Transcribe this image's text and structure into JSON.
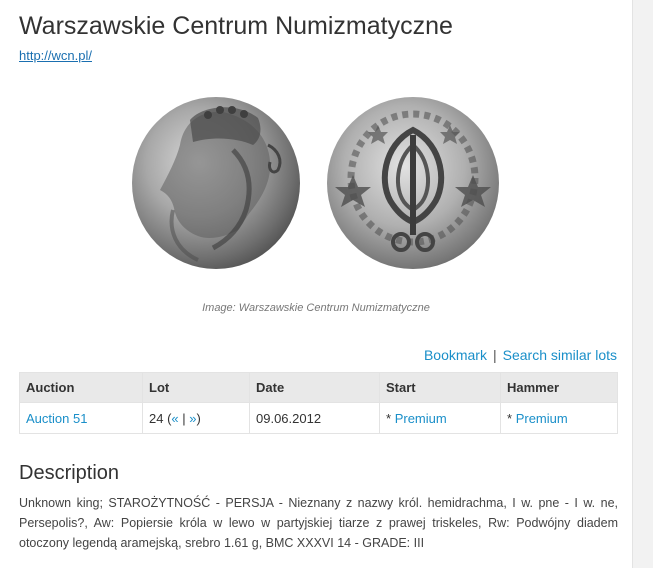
{
  "header": {
    "title": "Warszawskie Centrum Numizmatyczne",
    "link": "http://wcn.pl/"
  },
  "image": {
    "caption": "Image: Warszawskie Centrum Numizmatyczne",
    "obverse_icon": "coin-obverse-portrait",
    "reverse_icon": "coin-reverse-triskeles"
  },
  "actions": {
    "bookmark": "Bookmark",
    "separator": "|",
    "search_similar": "Search similar lots"
  },
  "table": {
    "headers": [
      "Auction",
      "Lot",
      "Date",
      "Start",
      "Hammer"
    ],
    "row": {
      "auction": "Auction 51",
      "lot_number": "24",
      "lot_prev": "«",
      "lot_sep": "|",
      "lot_next": "»",
      "date": "09.06.2012",
      "start_prefix": "*",
      "start_link": "Premium",
      "hammer_prefix": "*",
      "hammer_link": "Premium"
    }
  },
  "description": {
    "heading": "Description",
    "text": "Unknown king; STAROŻYTNOŚĆ - PERSJA - Nieznany z nazwy król. hemidrachma, I w. pne - I w. ne, Persepolis?, Aw: Popiersie króla w lewo w partyjskiej tiarze z prawej triskeles, Rw: Podwójny diadem otoczony legendą aramejską, srebro 1.61 g, BMC XXXVI 14 - GRADE: III"
  },
  "colors": {
    "link": "#1a8fc9",
    "title": "#333333",
    "table_header_bg": "#e9e9e9",
    "coin_silver": "#9a9a9a"
  }
}
